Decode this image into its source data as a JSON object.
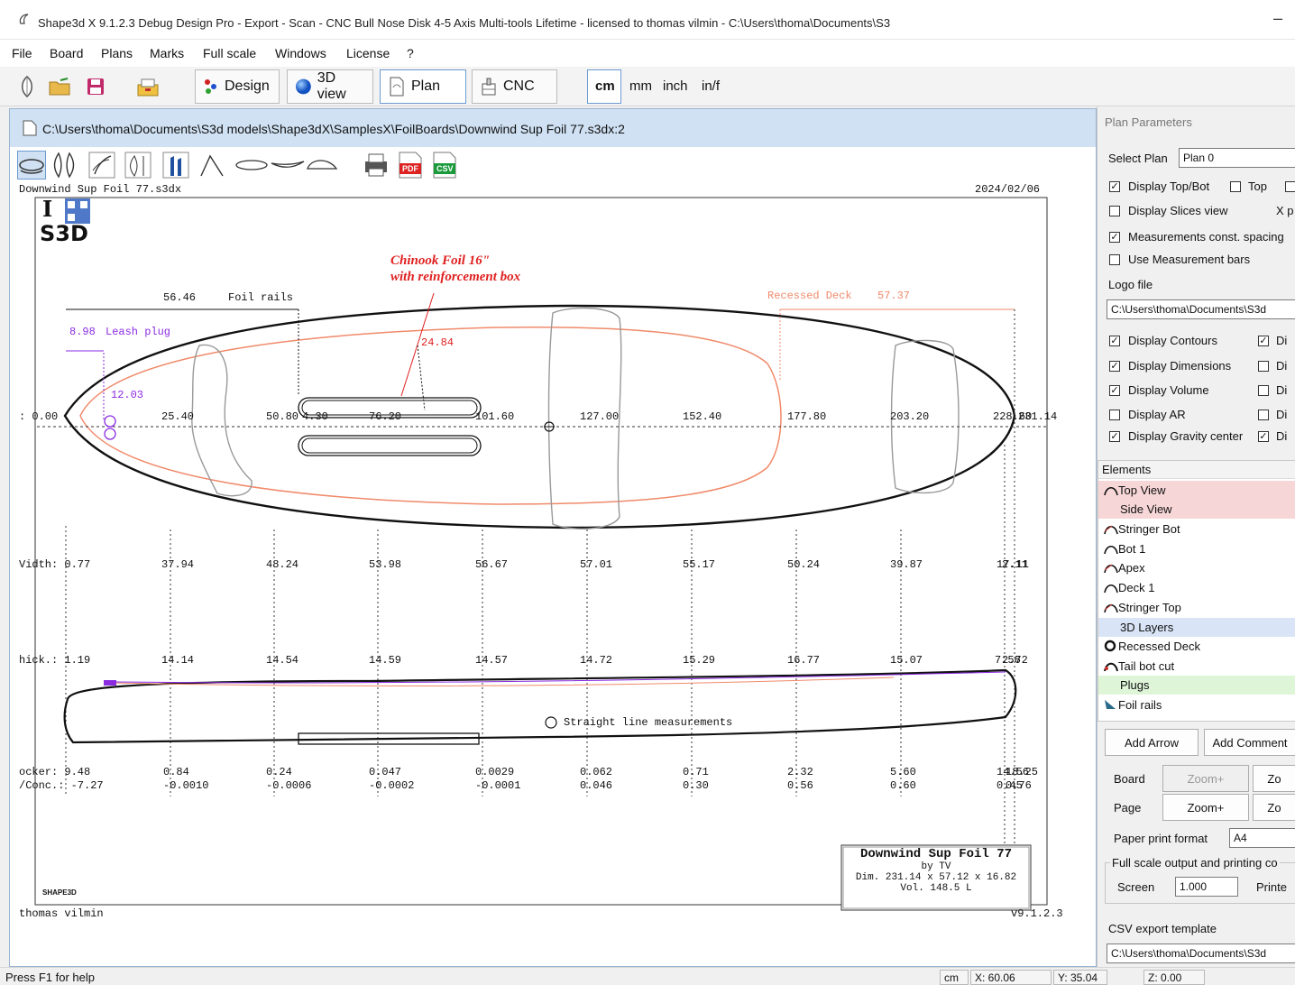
{
  "window": {
    "title": "Shape3d X 9.1.2.3 Debug Design Pro - Export - Scan - CNC Bull Nose Disk 4-5 Axis Multi-tools Lifetime - licensed to thomas vilmin - C:\\Users\\thoma\\Documents\\S3",
    "minimize": "–"
  },
  "menu": [
    "File",
    "Board",
    "Plans",
    "Marks",
    "Full scale",
    "Windows",
    "License",
    "?"
  ],
  "toolbar": {
    "design": "Design",
    "view3d": "3D view",
    "plan": "Plan",
    "cnc": "CNC",
    "units": [
      "cm",
      "mm",
      "inch",
      "in/f"
    ]
  },
  "document": {
    "path": "C:\\Users\\thoma\\Documents\\S3d models\\Shape3dX\\SamplesX\\FoilBoards\\Downwind Sup Foil 77.s3dx:2",
    "pdf": "PDF",
    "csv": "CSV"
  },
  "plan": {
    "file_name": "Downwind Sup Foil 77.s3dx",
    "date": "2024/02/06",
    "logo_i": "I",
    "logo_s3d": "S3D",
    "annotation_line1": "Chinook Foil 16\"",
    "annotation_line2": "with reinforcement box",
    "foil_rails_dim": "56.46",
    "foil_rails_label": "Foil rails",
    "recessed_deck_label": "Recessed Deck",
    "recessed_deck_dim": "57.37",
    "leash_dim": "8.98",
    "leash_label": "Leash plug",
    "leash_offset": "12.03",
    "box_diag": "24.84",
    "axis_start": ": 0.00",
    "axis_ticks": [
      "25.40",
      "50.80",
      "4.30",
      "76.20",
      "101.60",
      "127.00",
      "152.40",
      "177.80",
      "203.20",
      "228.60"
    ],
    "axis_end": "231.14",
    "width_label": "Vidth: 0.77",
    "width_values": [
      "37.94",
      "48.24",
      "53.98",
      "56.67",
      "57.01",
      "55.17",
      "50.24",
      "39.87",
      "17.11",
      "2.11"
    ],
    "thick_label": "hick.: 1.19",
    "thick_values": [
      "14.14",
      "14.54",
      "14.59",
      "14.57",
      "14.72",
      "15.29",
      "16.77",
      "15.07",
      "7.56",
      "2.72"
    ],
    "straight_line": "Straight line measurements",
    "rocker_label": "ocker: 9.48",
    "rocker_values": [
      "0.84",
      "0.24",
      "0.047",
      "0.0029",
      "0.062",
      "0.71",
      "2.32",
      "5.60",
      "14.56",
      "18.25"
    ],
    "vconc_label": "/Conc.: -7.27",
    "vconc_values": [
      "-0.0010",
      "-0.0006",
      "-0.0002",
      "-0.0001",
      "0.046",
      "0.30",
      "0.56",
      "0.60",
      "0.45",
      "0.76"
    ],
    "card_title": "Downwind Sup Foil 77",
    "card_by": "by TV",
    "card_dim": "Dim. 231.14 x 57.12 x 16.82",
    "card_vol": "Vol. 148.5 L",
    "shape3d_logo": "SHAPE3D",
    "author": "thomas vilmin",
    "version": "v9.1.2.3"
  },
  "panel": {
    "title": "Plan Parameters",
    "select_plan_label": "Select Plan",
    "select_plan_value": "Plan 0",
    "display_topbot": "Display Top/Bot",
    "top": "Top",
    "display_slices": "Display Slices view",
    "x_cut": "X p",
    "measurements_const": "Measurements const. spacing",
    "use_measurement_bars": "Use Measurement bars",
    "logo_file_label": "Logo file",
    "logo_file_value": "C:\\Users\\thoma\\Documents\\S3d",
    "display_contours": "Display Contours",
    "display_dimensions": "Display Dimensions",
    "display_volume": "Display Volume",
    "display_ar": "Display AR",
    "display_gravity": "Display Gravity center",
    "di": "Di",
    "elements_header": "Elements",
    "elements": [
      "Top View",
      "Side View",
      "Stringer Bot",
      "Bot 1",
      "Apex",
      "Deck 1",
      "Stringer Top",
      "3D Layers",
      "Recessed Deck",
      "Tail bot cut",
      "Plugs",
      "Foil rails"
    ],
    "add_arrow": "Add Arrow",
    "add_comment": "Add Comment",
    "board_label": "Board",
    "page_label": "Page",
    "zoom_plus": "Zoom+",
    "zoom_minus": "Zo",
    "paper_format_label": "Paper print format",
    "paper_format_value": "A4",
    "full_scale_group": "Full scale output and printing co",
    "screen_label": "Screen",
    "screen_value": "1.000",
    "printer_label": "Printe",
    "csv_label": "CSV export template",
    "csv_value": "C:\\Users\\thoma\\Documents\\S3d"
  },
  "status": {
    "help": "Press F1 for help",
    "unit": "cm",
    "x": "X: 60.06",
    "y": "Y: 35.04",
    "z": "Z: 0.00"
  },
  "colors": {
    "accent_blue": "#2f6fd6",
    "outline_orange": "#f08a6a",
    "purple": "#8a2be2",
    "red_annotation": "#e02020"
  }
}
